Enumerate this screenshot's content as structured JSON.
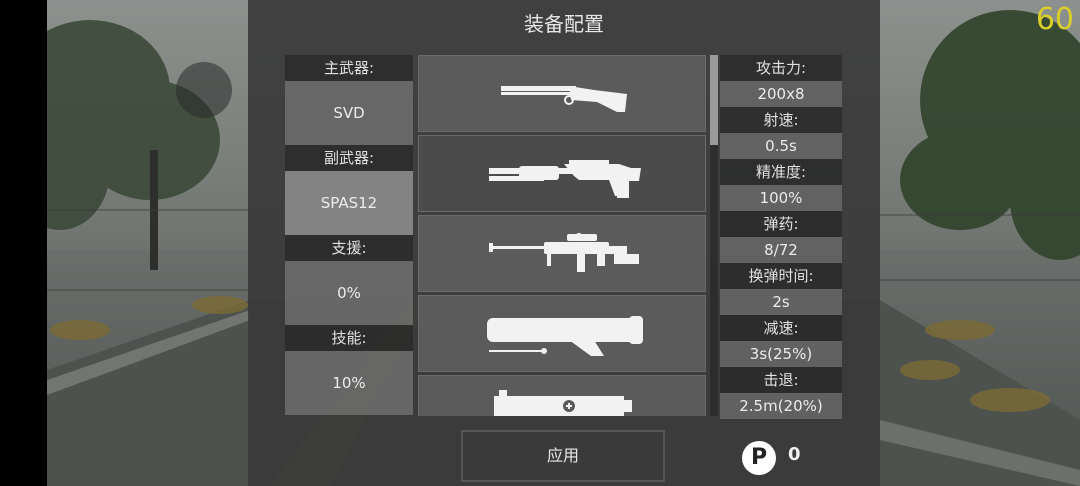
{
  "fps": "60",
  "title": "装备配置",
  "loadout": [
    {
      "label": "主武器:",
      "value": "SVD",
      "selected": false
    },
    {
      "label": "副武器:",
      "value": "SPAS12",
      "selected": true
    },
    {
      "label": "支援:",
      "value": "0%",
      "selected": false
    },
    {
      "label": "技能:",
      "value": "10%",
      "selected": false
    }
  ],
  "weapons": [
    {
      "icon": "double-barrel-shotgun-icon"
    },
    {
      "icon": "pump-shotgun-icon"
    },
    {
      "icon": "sniper-rifle-icon"
    },
    {
      "icon": "energy-rifle-icon"
    },
    {
      "icon": "heavy-gun-icon"
    }
  ],
  "stats": [
    {
      "label": "攻击力:",
      "value": "200x8"
    },
    {
      "label": "射速:",
      "value": "0.5s"
    },
    {
      "label": "精准度:",
      "value": "100%"
    },
    {
      "label": "弹药:",
      "value": "8/72"
    },
    {
      "label": "换弹时间:",
      "value": "2s"
    },
    {
      "label": "减速:",
      "value": "3s(25%)"
    },
    {
      "label": "击退:",
      "value": "2.5m(20%)"
    }
  ],
  "apply_label": "应用",
  "points": {
    "symbol": "P",
    "count": "0"
  }
}
